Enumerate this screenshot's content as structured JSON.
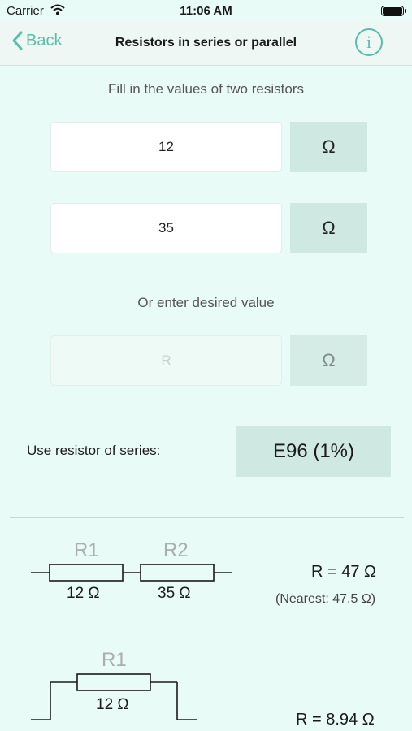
{
  "status": {
    "carrier": "Carrier",
    "time": "11:06 AM"
  },
  "nav": {
    "back": "Back",
    "title": "Resistors in series or parallel",
    "info": "i"
  },
  "form": {
    "prompt": "Fill in the values of two resistors",
    "r1_value": "12",
    "r2_value": "35",
    "unit": "Ω",
    "desired_prompt": "Or enter desired value",
    "desired_placeholder": "R",
    "series_label": "Use resistor of series:",
    "series_value": "E96 (1%)"
  },
  "series_circuit": {
    "r1_label": "R1",
    "r2_label": "R2",
    "r1_value": "12 Ω",
    "r2_value": "35 Ω",
    "result": "R = 47 Ω",
    "nearest": "(Nearest: 47.5 Ω)"
  },
  "parallel_circuit": {
    "r1_label": "R1",
    "r1_value": "12 Ω",
    "result": "R = 8.94 Ω"
  }
}
